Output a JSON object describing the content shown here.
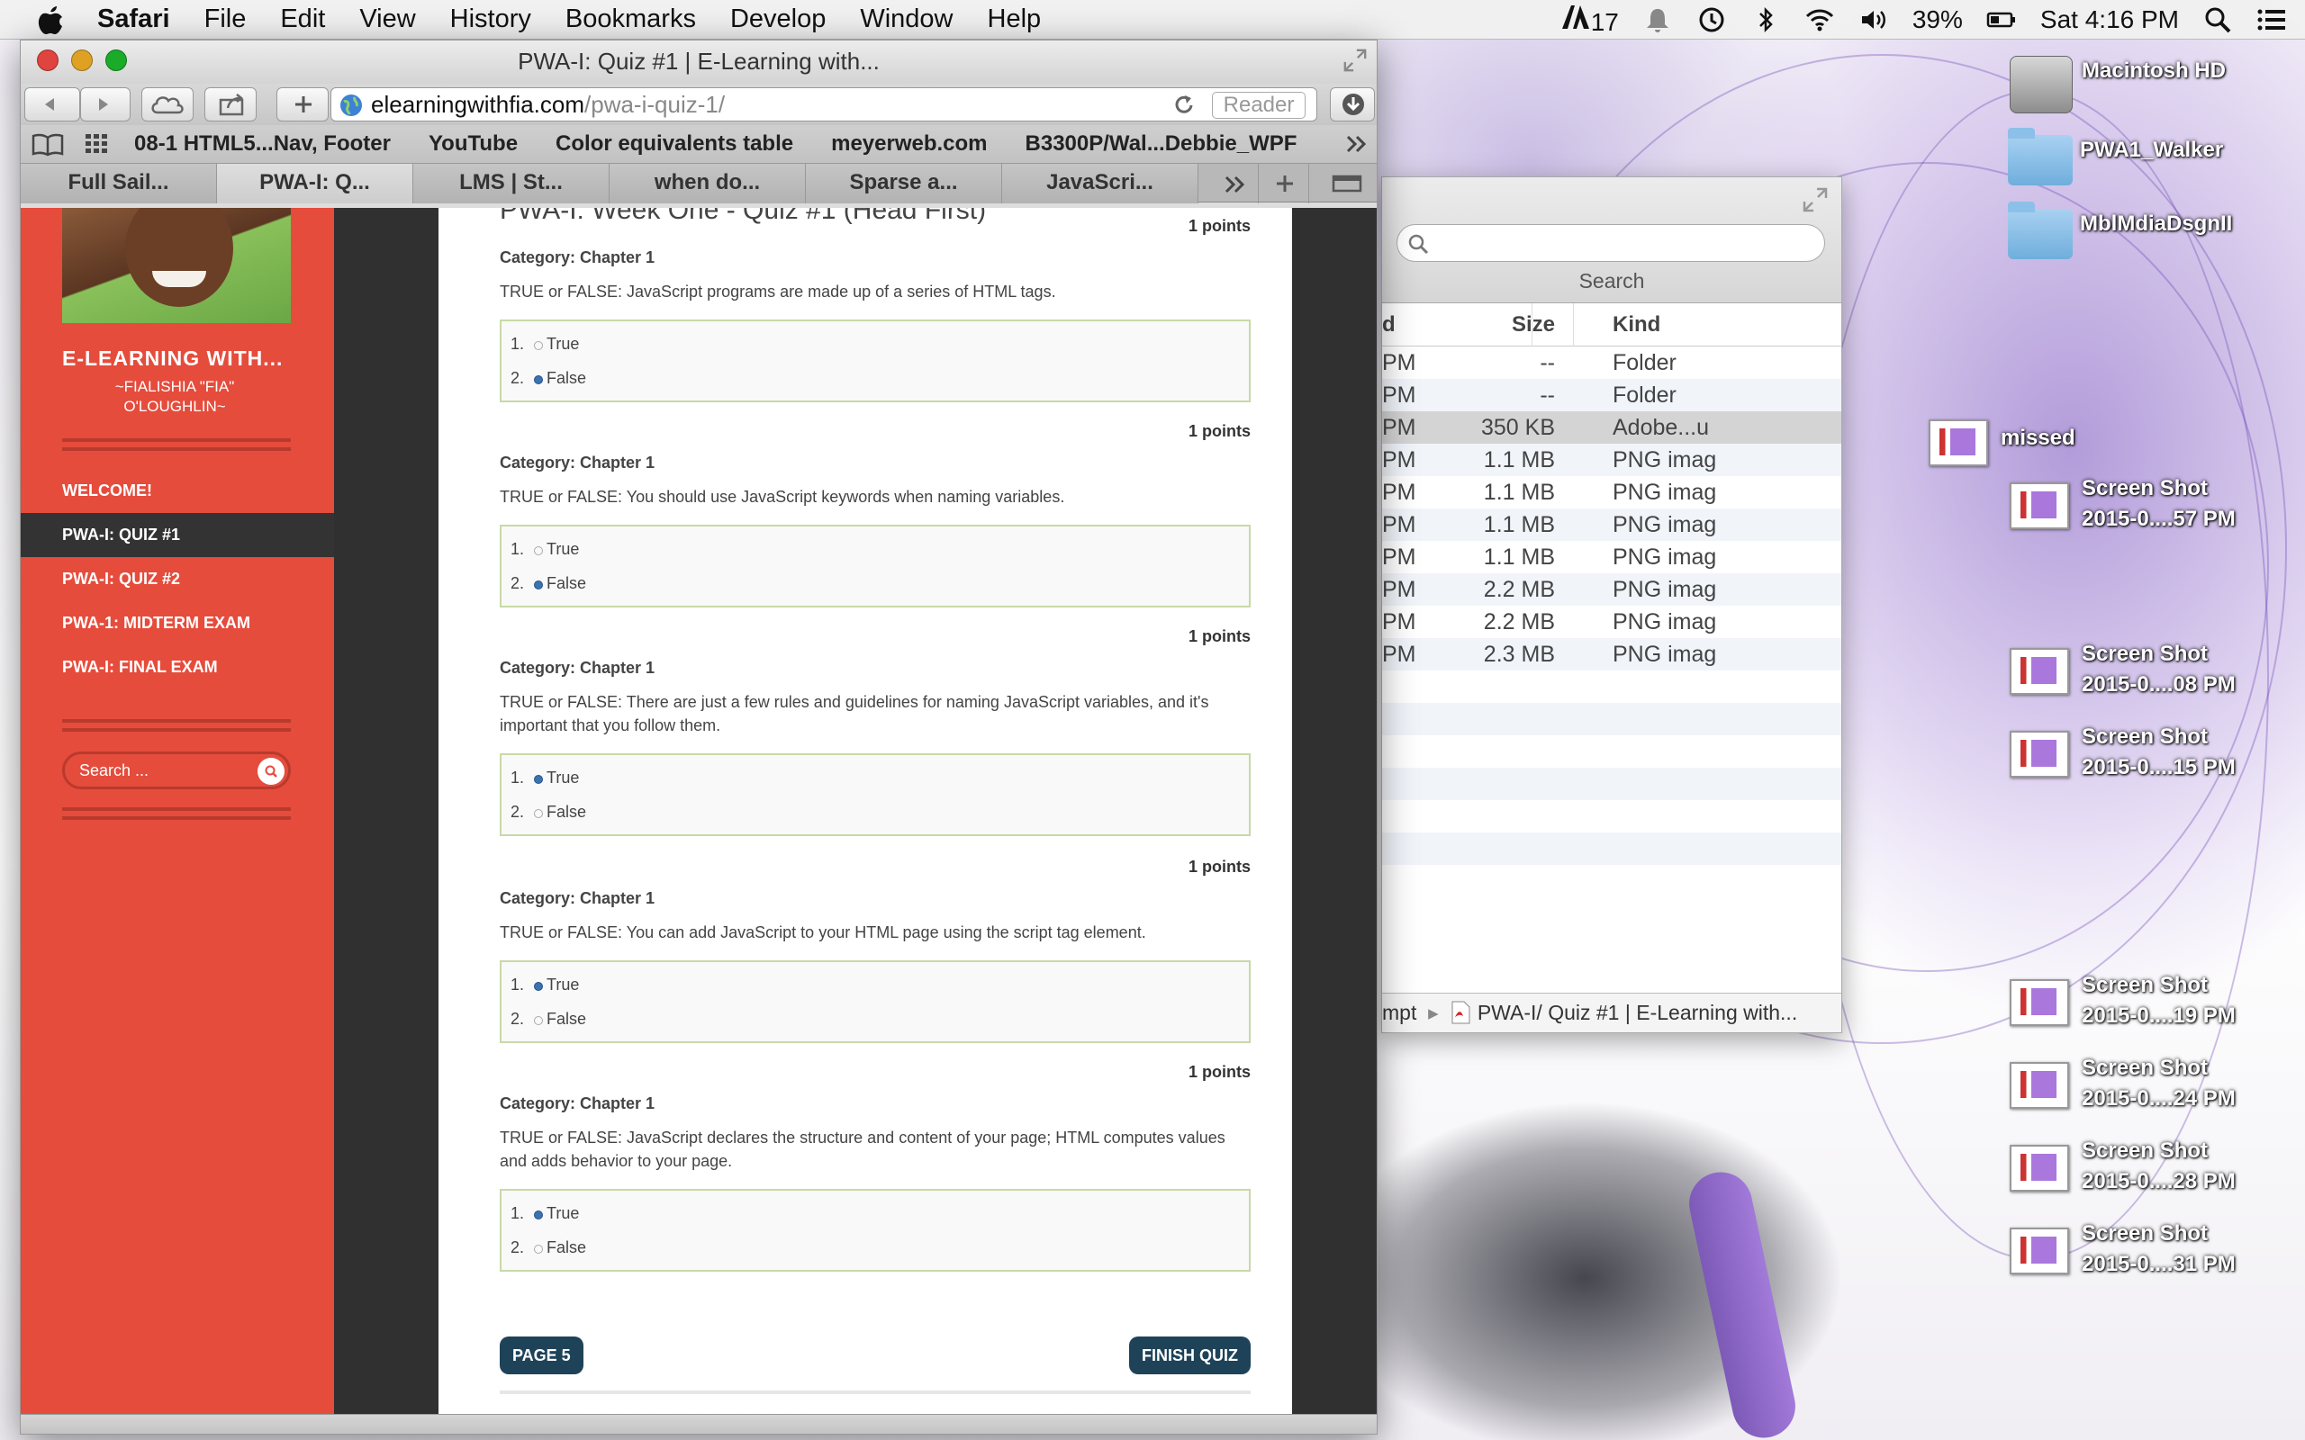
{
  "menubar": {
    "app": "Safari",
    "items": [
      "File",
      "Edit",
      "View",
      "History",
      "Bookmarks",
      "Develop",
      "Window",
      "Help"
    ],
    "adobe_count": "17",
    "battery": "39%",
    "clock": "Sat 4:16 PM"
  },
  "safari": {
    "title": "PWA-I: Quiz #1 | E-Learning with...",
    "url_host": "elearningwithfia.com",
    "url_path": "/pwa-i-quiz-1/",
    "reader": "Reader",
    "bookmarks": [
      "08-1 HTML5...Nav, Footer",
      "YouTube",
      "Color equivalents table",
      "meyerweb.com",
      "B3300P/Wal...Debbie_WPF"
    ],
    "tabs": [
      "Full Sail...",
      "PWA-I: Q...",
      "LMS | St...",
      "when do...",
      "Sparse a...",
      "JavaScri..."
    ],
    "active_tab": 1
  },
  "site": {
    "title": "E-LEARNING WITH...",
    "subtitle": "~FIALISHIA \"FIA\" O'LOUGHLIN~",
    "nav": [
      "WELCOME!",
      "PWA-I: QUIZ #1",
      "PWA-I: QUIZ #2",
      "PWA-1: MIDTERM EXAM",
      "PWA-I: FINAL EXAM"
    ],
    "active_nav": 1,
    "search_placeholder": "Search ..."
  },
  "quiz": {
    "heading": "PWA-I: Week One - Quiz #1 (Head First)",
    "questions": [
      {
        "points": "1 points",
        "category": "Category: Chapter 1",
        "text": "TRUE or FALSE:  JavaScript programs are made up of a series of HTML tags.",
        "answers": [
          "1. ",
          "2. "
        ],
        "answer_labels": [
          "True",
          "False"
        ],
        "selected": 1
      },
      {
        "points": "1 points",
        "category": "Category: Chapter 1",
        "text": "TRUE or FALSE:  You should use JavaScript keywords when naming variables.",
        "answers": [
          "1. ",
          "2. "
        ],
        "answer_labels": [
          "True",
          "False"
        ],
        "selected": 1
      },
      {
        "points": "1 points",
        "category": "Category: Chapter 1",
        "text": "TRUE or FALSE:  There are just a few rules and guidelines for naming JavaScript variables, and it's important that you follow them.",
        "answers": [
          "1. ",
          "2. "
        ],
        "answer_labels": [
          "True",
          "False"
        ],
        "selected": 0
      },
      {
        "points": "1 points",
        "category": "Category: Chapter 1",
        "text": "TRUE or FALSE:  You can add JavaScript to your HTML page using the script tag element.",
        "answers": [
          "1. ",
          "2. "
        ],
        "answer_labels": [
          "True",
          "False"
        ],
        "selected": 0
      },
      {
        "points": "1 points",
        "category": "Category: Chapter 1",
        "text": "TRUE or FALSE:  JavaScript declares the structure and content of your page; HTML computes values and adds behavior to your page.",
        "answers": [
          "1. ",
          "2. "
        ],
        "answer_labels": [
          "True",
          "False"
        ],
        "selected": 0
      }
    ],
    "prev_button": "PAGE 5",
    "finish_button": "FINISH QUIZ"
  },
  "finder": {
    "search_label": "Search",
    "columns": [
      "d",
      "Size",
      "Kind"
    ],
    "rows": [
      {
        "date": "PM",
        "size": "--",
        "kind": "Folder"
      },
      {
        "date": "PM",
        "size": "--",
        "kind": "Folder"
      },
      {
        "date": "PM",
        "size": "350 KB",
        "kind": "Adobe...u"
      },
      {
        "date": "PM",
        "size": "1.1 MB",
        "kind": "PNG imag"
      },
      {
        "date": "PM",
        "size": "1.1 MB",
        "kind": "PNG imag"
      },
      {
        "date": "PM",
        "size": "1.1 MB",
        "kind": "PNG imag"
      },
      {
        "date": "PM",
        "size": "1.1 MB",
        "kind": "PNG imag"
      },
      {
        "date": "PM",
        "size": "2.2 MB",
        "kind": "PNG imag"
      },
      {
        "date": "PM",
        "size": "2.2 MB",
        "kind": "PNG imag"
      },
      {
        "date": "PM",
        "size": "2.3 MB",
        "kind": "PNG imag"
      }
    ],
    "selected_row": 2,
    "path_prefix": "mpt",
    "path_file": "PWA-I/ Quiz #1 | E-Learning with..."
  },
  "desktop": {
    "drives": [
      {
        "label": "Macintosh HD",
        "icon": "hard-drive-icon"
      },
      {
        "label": "PWA1_Walker",
        "icon": "folder-icon"
      },
      {
        "label": "MblMdiaDsgnII",
        "icon": "folder-icon"
      }
    ],
    "missed": "missed",
    "screenshots": [
      {
        "line1": "Screen Shot",
        "line2": "2015-0....57 PM"
      },
      {
        "line1": "Screen Shot",
        "line2": "2015-0....08 PM"
      },
      {
        "line1": "Screen Shot",
        "line2": "2015-0....15 PM"
      },
      {
        "line1": "Screen Shot",
        "line2": "2015-0....19 PM"
      },
      {
        "line1": "Screen Shot",
        "line2": "2015-0....24 PM"
      },
      {
        "line1": "Screen Shot",
        "line2": "2015-0....28 PM"
      },
      {
        "line1": "Screen Shot",
        "line2": "2015-0....31 PM"
      }
    ]
  },
  "colors": {
    "sidebar": "#e54c3c",
    "button": "#1e4359",
    "answer_border": "#c8d9a7"
  }
}
